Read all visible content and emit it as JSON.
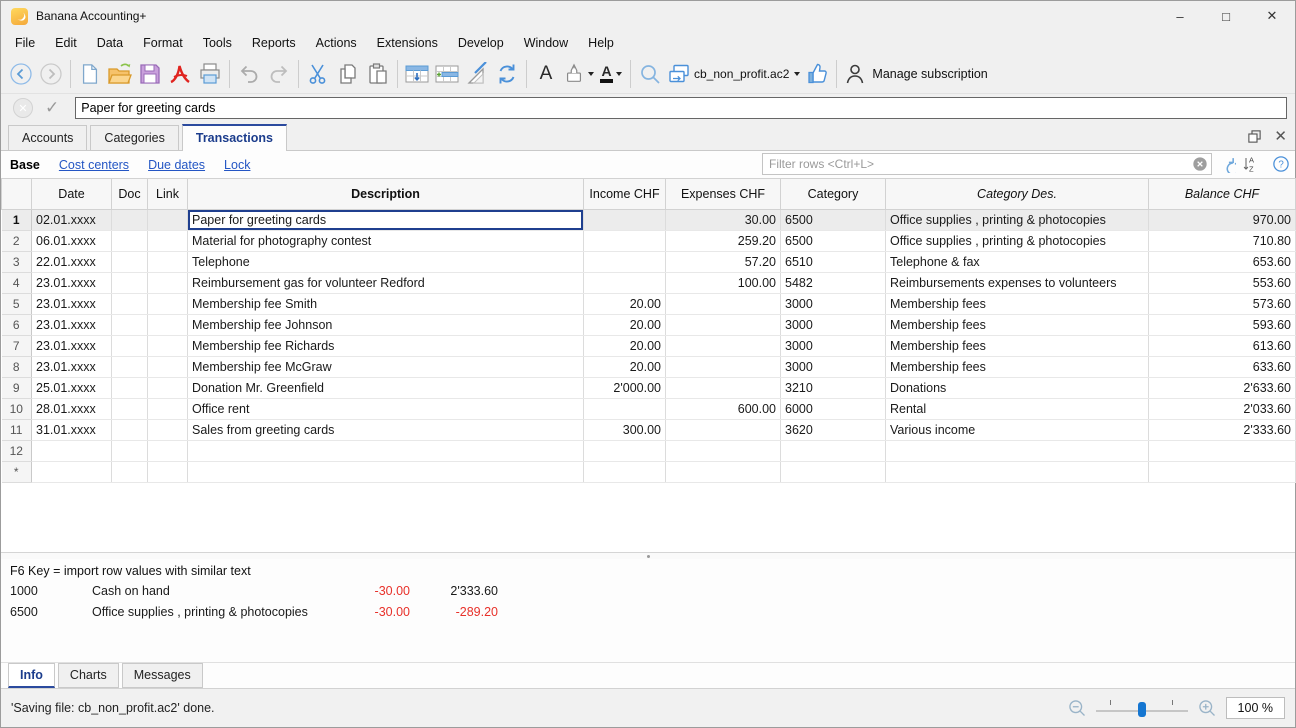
{
  "window": {
    "title": "Banana Accounting+"
  },
  "menu": {
    "items": [
      "File",
      "Edit",
      "Data",
      "Format",
      "Tools",
      "Reports",
      "Actions",
      "Extensions",
      "Develop",
      "Window",
      "Help"
    ]
  },
  "toolbar": {
    "file_selector": "cb_non_profit.ac2",
    "manage_subscription": "Manage subscription"
  },
  "edit_row": {
    "value": "Paper for greeting cards"
  },
  "main_tabs": {
    "items": [
      {
        "label": "Accounts",
        "active": false
      },
      {
        "label": "Categories",
        "active": false
      },
      {
        "label": "Transactions",
        "active": true
      }
    ]
  },
  "view_links": {
    "items": [
      {
        "label": "Base",
        "active": true
      },
      {
        "label": "Cost centers",
        "active": false
      },
      {
        "label": "Due dates",
        "active": false
      },
      {
        "label": "Lock",
        "active": false
      }
    ]
  },
  "filter": {
    "placeholder": "Filter rows <Ctrl+L>"
  },
  "table": {
    "headers": [
      "",
      "Date",
      "Doc",
      "Link",
      "Description",
      "Income CHF",
      "Expenses CHF",
      "Category",
      "Category Des.",
      "Balance CHF"
    ],
    "rows": [
      {
        "num": "1",
        "date": "02.01.xxxx",
        "description": "Paper for greeting cards",
        "income": "",
        "expenses": "30.00",
        "category": "6500",
        "category_des": "Office supplies , printing & photocopies",
        "balance": "970.00",
        "selected": true
      },
      {
        "num": "2",
        "date": "06.01.xxxx",
        "description": "Material for photography contest",
        "income": "",
        "expenses": "259.20",
        "category": "6500",
        "category_des": "Office supplies , printing & photocopies",
        "balance": "710.80"
      },
      {
        "num": "3",
        "date": "22.01.xxxx",
        "description": "Telephone",
        "income": "",
        "expenses": "57.20",
        "category": "6510",
        "category_des": "Telephone & fax",
        "balance": "653.60"
      },
      {
        "num": "4",
        "date": "23.01.xxxx",
        "description": "Reimbursement gas for volunteer Redford",
        "income": "",
        "expenses": "100.00",
        "category": "5482",
        "category_des": "Reimbursements expenses to volunteers",
        "balance": "553.60"
      },
      {
        "num": "5",
        "date": "23.01.xxxx",
        "description": "Membership fee Smith",
        "income": "20.00",
        "expenses": "",
        "category": "3000",
        "category_des": "Membership fees",
        "balance": "573.60"
      },
      {
        "num": "6",
        "date": "23.01.xxxx",
        "description": "Membership fee Johnson",
        "income": "20.00",
        "expenses": "",
        "category": "3000",
        "category_des": "Membership fees",
        "balance": "593.60"
      },
      {
        "num": "7",
        "date": "23.01.xxxx",
        "description": "Membership fee Richards",
        "income": "20.00",
        "expenses": "",
        "category": "3000",
        "category_des": "Membership fees",
        "balance": "613.60"
      },
      {
        "num": "8",
        "date": "23.01.xxxx",
        "description": "Membership fee McGraw",
        "income": "20.00",
        "expenses": "",
        "category": "3000",
        "category_des": "Membership fees",
        "balance": "633.60"
      },
      {
        "num": "9",
        "date": "25.01.xxxx",
        "description": "Donation Mr. Greenfield",
        "income": "2'000.00",
        "expenses": "",
        "category": "3210",
        "category_des": "Donations",
        "balance": "2'633.60"
      },
      {
        "num": "10",
        "date": "28.01.xxxx",
        "description": "Office rent",
        "income": "",
        "expenses": "600.00",
        "category": "6000",
        "category_des": "Rental",
        "balance": "2'033.60"
      },
      {
        "num": "11",
        "date": "31.01.xxxx",
        "description": "Sales from greeting cards",
        "income": "300.00",
        "expenses": "",
        "category": "3620",
        "category_des": "Various income",
        "balance": "2'333.60"
      },
      {
        "num": "12",
        "date": "",
        "description": "",
        "income": "",
        "expenses": "",
        "category": "",
        "category_des": "",
        "balance": ""
      },
      {
        "num": "*",
        "date": "",
        "description": "",
        "income": "",
        "expenses": "",
        "category": "",
        "category_des": "",
        "balance": ""
      }
    ]
  },
  "info_panel": {
    "hint": "F6 Key = import row values with similar text",
    "accounts": [
      {
        "code": "1000",
        "name": "Cash on hand",
        "amount": "-30.00",
        "amount_negative": true,
        "balance": "2'333.60",
        "balance_negative": false
      },
      {
        "code": "6500",
        "name": "Office supplies , printing & photocopies",
        "amount": "-30.00",
        "amount_negative": true,
        "balance": "-289.20",
        "balance_negative": true
      }
    ]
  },
  "bottom_tabs": {
    "items": [
      {
        "label": "Info",
        "active": true
      },
      {
        "label": "Charts",
        "active": false
      },
      {
        "label": "Messages",
        "active": false
      }
    ]
  },
  "status_bar": {
    "message": "'Saving file: cb_non_profit.ac2' done.",
    "zoom_level": "100 %"
  }
}
